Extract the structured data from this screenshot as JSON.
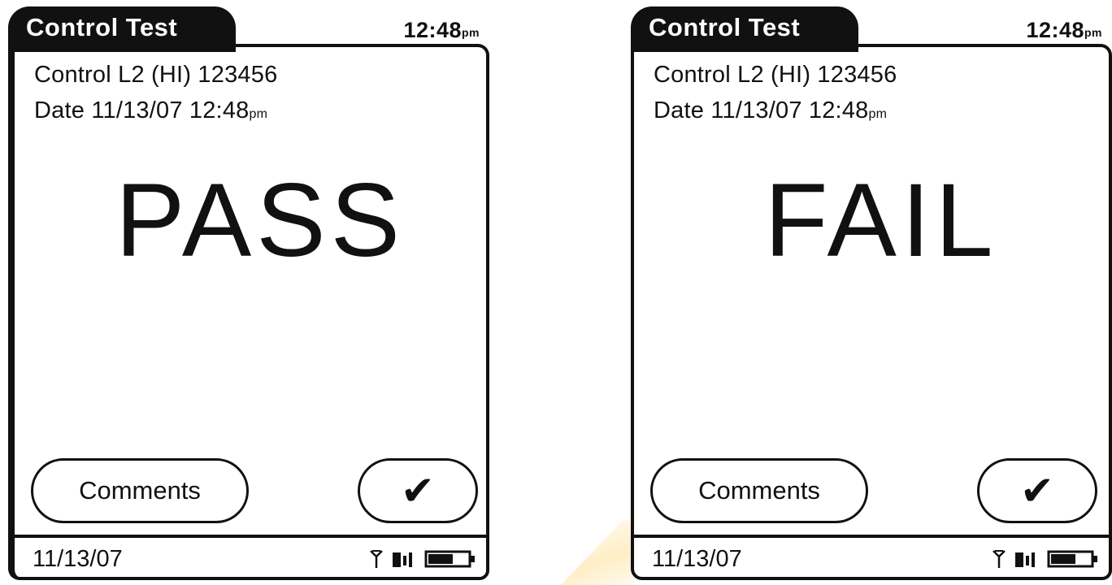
{
  "screens": [
    {
      "title": "Control Test",
      "clock": {
        "time": "12:48",
        "suffix": "pm"
      },
      "control_line": "Control L2 (HI) 123456",
      "date_line": {
        "text": "Date 11/13/07 12:48",
        "suffix": "pm"
      },
      "result": "PASS",
      "comments_label": "Comments",
      "confirm_symbol": "✔",
      "footer_date": "11/13/07",
      "icons": [
        "antenna-icon",
        "signal-icon",
        "battery-icon"
      ]
    },
    {
      "title": "Control Test",
      "clock": {
        "time": "12:48",
        "suffix": "pm"
      },
      "control_line": "Control L2 (HI) 123456",
      "date_line": {
        "text": "Date 11/13/07 12:48",
        "suffix": "pm"
      },
      "result": "FAIL",
      "comments_label": "Comments",
      "confirm_symbol": "✔",
      "footer_date": "11/13/07",
      "icons": [
        "antenna-icon",
        "signal-icon",
        "battery-icon"
      ]
    }
  ],
  "colors": {
    "ink": "#111111",
    "background": "#ffffff",
    "highlight": "#ffe096"
  }
}
